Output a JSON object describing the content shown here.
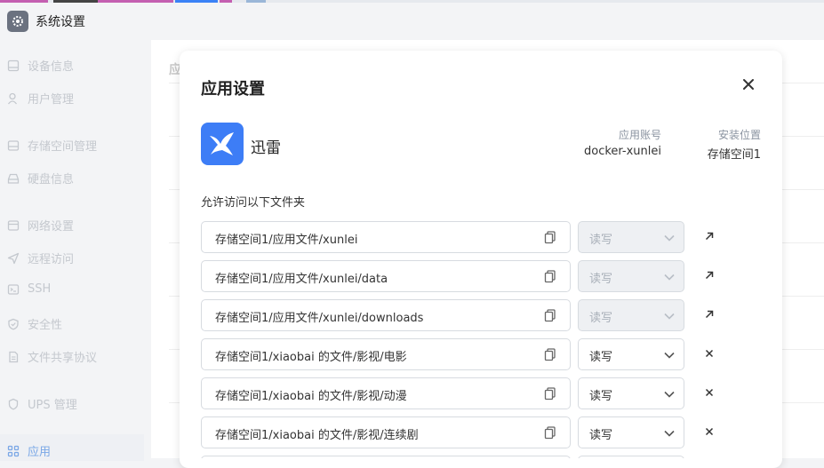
{
  "window": {
    "title": "系统设置"
  },
  "sidebar": {
    "items": [
      {
        "label": "设备信息",
        "icon": "device-icon"
      },
      {
        "label": "用户管理",
        "icon": "user-icon"
      },
      {
        "label": "存储空间管理",
        "icon": "storage-icon"
      },
      {
        "label": "硬盘信息",
        "icon": "disk-icon"
      },
      {
        "label": "网络设置",
        "icon": "network-icon"
      },
      {
        "label": "远程访问",
        "icon": "send-icon"
      },
      {
        "label": "SSH",
        "icon": "terminal-icon"
      },
      {
        "label": "安全性",
        "icon": "shield-icon"
      },
      {
        "label": "文件共享协议",
        "icon": "file-icon"
      },
      {
        "label": "UPS 管理",
        "icon": "battery-icon"
      },
      {
        "label": "应用",
        "icon": "apps-icon",
        "active": true
      }
    ]
  },
  "background": {
    "heading": "应"
  },
  "modal": {
    "title": "应用设置",
    "app_name": "迅雷",
    "account_label": "应用账号",
    "account_value": "docker-xunlei",
    "location_label": "安装位置",
    "location_value": "存储空间1",
    "section_label": "允许访问以下文件夹",
    "folders": [
      {
        "path": "存储空间1/应用文件/xunlei",
        "permission": "读写",
        "disabled": true,
        "action": "open-link-icon"
      },
      {
        "path": "存储空间1/应用文件/xunlei/data",
        "permission": "读写",
        "disabled": true,
        "action": "open-link-icon"
      },
      {
        "path": "存储空间1/应用文件/xunlei/downloads",
        "permission": "读写",
        "disabled": true,
        "action": "open-link-icon"
      },
      {
        "path": "存储空间1/xiaobai 的文件/影视/电影",
        "permission": "读写",
        "disabled": false,
        "action": "remove-icon"
      },
      {
        "path": "存储空间1/xiaobai 的文件/影视/动漫",
        "permission": "读写",
        "disabled": false,
        "action": "remove-icon"
      },
      {
        "path": "存储空间1/xiaobai 的文件/影视/连续剧",
        "permission": "读写",
        "disabled": false,
        "action": "remove-icon"
      }
    ]
  },
  "colors": {
    "accent": "#3d7df6",
    "sidebar_text": "#c4c8ce",
    "active_text": "#7aa7e6"
  }
}
